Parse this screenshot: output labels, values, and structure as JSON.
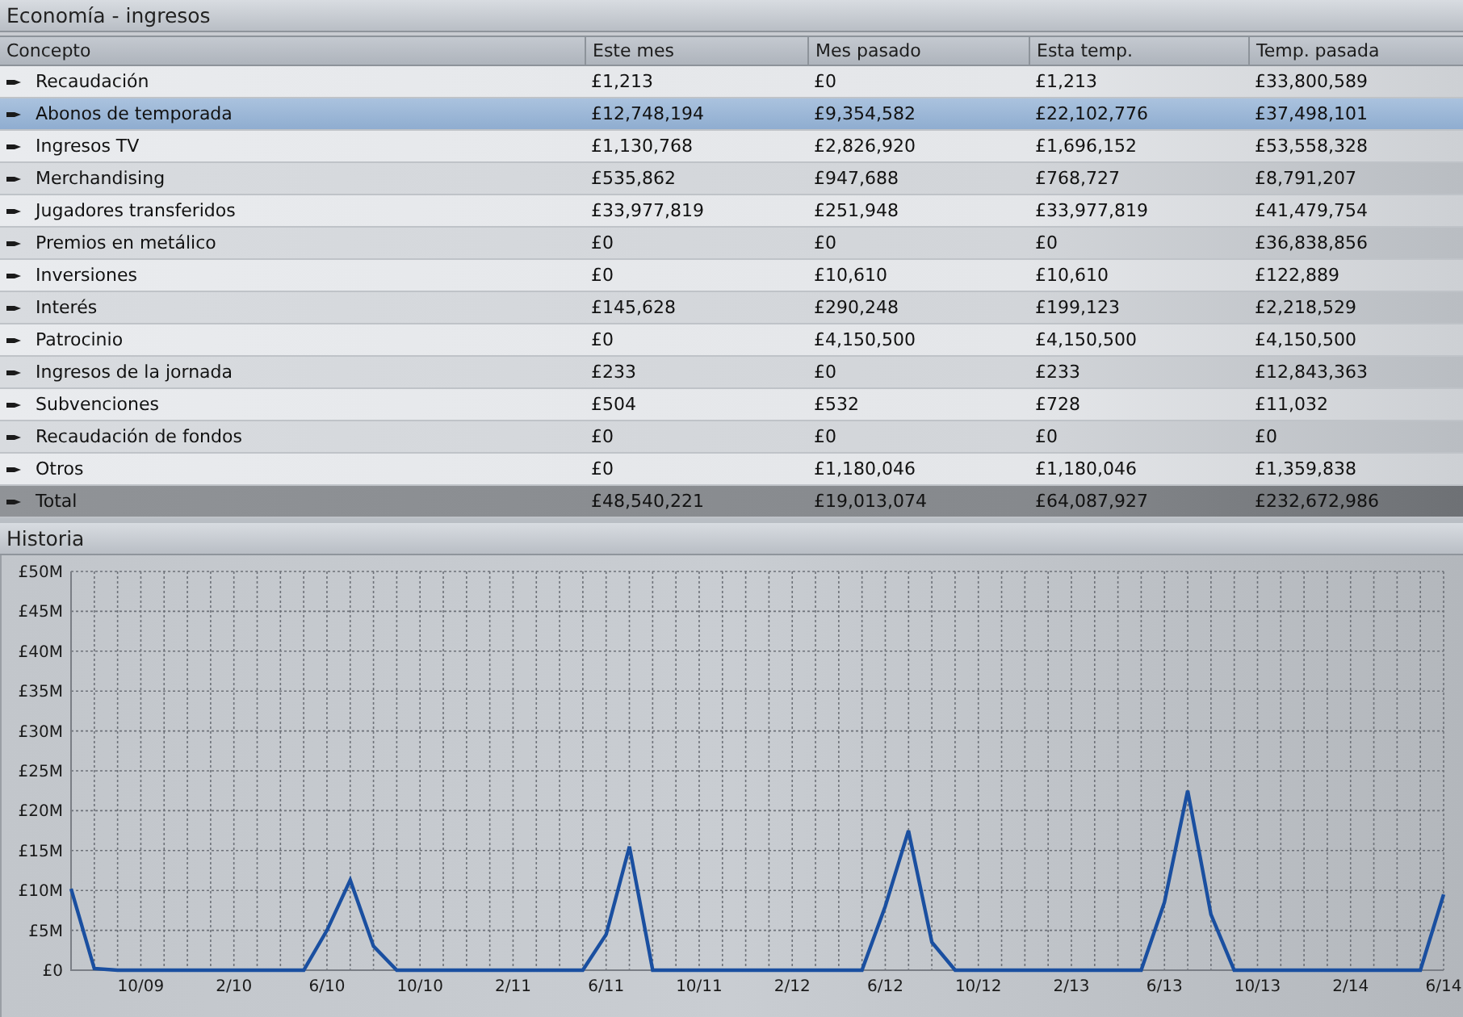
{
  "window": {
    "title": "Economía - ingresos"
  },
  "table": {
    "columns": [
      "Concepto",
      "Este mes",
      "Mes pasado",
      "Esta temp.",
      "Temp. pasada"
    ],
    "rows": [
      {
        "kind": "item",
        "selected": false,
        "cells": [
          "Recaudación",
          "£1,213",
          "£0",
          "£1,213",
          "£33,800,589"
        ]
      },
      {
        "kind": "item",
        "selected": true,
        "cells": [
          "Abonos de temporada",
          "£12,748,194",
          "£9,354,582",
          "£22,102,776",
          "£37,498,101"
        ]
      },
      {
        "kind": "item",
        "selected": false,
        "cells": [
          "Ingresos TV",
          "£1,130,768",
          "£2,826,920",
          "£1,696,152",
          "£53,558,328"
        ]
      },
      {
        "kind": "item",
        "selected": false,
        "cells": [
          "Merchandising",
          "£535,862",
          "£947,688",
          "£768,727",
          "£8,791,207"
        ]
      },
      {
        "kind": "item",
        "selected": false,
        "cells": [
          "Jugadores transferidos",
          "£33,977,819",
          "£251,948",
          "£33,977,819",
          "£41,479,754"
        ]
      },
      {
        "kind": "item",
        "selected": false,
        "cells": [
          "Premios en metálico",
          "£0",
          "£0",
          "£0",
          "£36,838,856"
        ]
      },
      {
        "kind": "item",
        "selected": false,
        "cells": [
          "Inversiones",
          "£0",
          "£10,610",
          "£10,610",
          "£122,889"
        ]
      },
      {
        "kind": "item",
        "selected": false,
        "cells": [
          "Interés",
          "£145,628",
          "£290,248",
          "£199,123",
          "£2,218,529"
        ]
      },
      {
        "kind": "item",
        "selected": false,
        "cells": [
          "Patrocinio",
          "£0",
          "£4,150,500",
          "£4,150,500",
          "£4,150,500"
        ]
      },
      {
        "kind": "item",
        "selected": false,
        "cells": [
          "Ingresos de la jornada",
          "£233",
          "£0",
          "£233",
          "£12,843,363"
        ]
      },
      {
        "kind": "item",
        "selected": false,
        "cells": [
          "Subvenciones",
          "£504",
          "£532",
          "£728",
          "£11,032"
        ]
      },
      {
        "kind": "item",
        "selected": false,
        "cells": [
          "Recaudación de fondos",
          "£0",
          "£0",
          "£0",
          "£0"
        ]
      },
      {
        "kind": "item",
        "selected": false,
        "cells": [
          "Otros",
          "£0",
          "£1,180,046",
          "£1,180,046",
          "£1,359,838"
        ]
      },
      {
        "kind": "total",
        "selected": false,
        "cells": [
          "Total",
          "£48,540,221",
          "£19,013,074",
          "£64,087,927",
          "£232,672,986"
        ]
      }
    ]
  },
  "history": {
    "title": "Historia",
    "chart_data": {
      "type": "line",
      "categories": [
        null,
        null,
        null,
        "10/09",
        null,
        null,
        null,
        "2/10",
        null,
        null,
        null,
        "6/10",
        null,
        null,
        null,
        "10/10",
        null,
        null,
        null,
        "2/11",
        null,
        null,
        null,
        "6/11",
        null,
        null,
        null,
        "10/11",
        null,
        null,
        null,
        "2/12",
        null,
        null,
        null,
        "6/12",
        null,
        null,
        null,
        "10/12",
        null,
        null,
        null,
        "2/13",
        null,
        null,
        null,
        "6/13",
        null,
        null,
        null,
        "10/13",
        null,
        null,
        null,
        "2/14",
        null,
        null,
        null,
        "6/14"
      ],
      "series": [
        {
          "color": "#1a4fa0",
          "values": [
            10200000,
            200000,
            0,
            0,
            0,
            0,
            0,
            0,
            0,
            0,
            0,
            5000000,
            11300000,
            3000000,
            0,
            0,
            0,
            0,
            0,
            0,
            0,
            0,
            0,
            4500000,
            15500000,
            0,
            0,
            0,
            0,
            0,
            0,
            0,
            0,
            0,
            0,
            8000000,
            17500000,
            3500000,
            0,
            0,
            0,
            0,
            0,
            0,
            0,
            0,
            0,
            8500000,
            22500000,
            7000000,
            0,
            0,
            0,
            0,
            0,
            0,
            0,
            0,
            0,
            9500000
          ]
        }
      ],
      "ylim": [
        0,
        50000000
      ],
      "grid": true,
      "yticks": [
        {
          "value": 0,
          "label": "£0"
        },
        {
          "value": 5000000,
          "label": "£5M"
        },
        {
          "value": 10000000,
          "label": "£10M"
        },
        {
          "value": 15000000,
          "label": "£15M"
        },
        {
          "value": 20000000,
          "label": "£20M"
        },
        {
          "value": 25000000,
          "label": "£25M"
        },
        {
          "value": 30000000,
          "label": "£30M"
        },
        {
          "value": 35000000,
          "label": "£35M"
        },
        {
          "value": 40000000,
          "label": "£40M"
        },
        {
          "value": 45000000,
          "label": "£45M"
        },
        {
          "value": 50000000,
          "label": "£50M"
        }
      ]
    }
  }
}
